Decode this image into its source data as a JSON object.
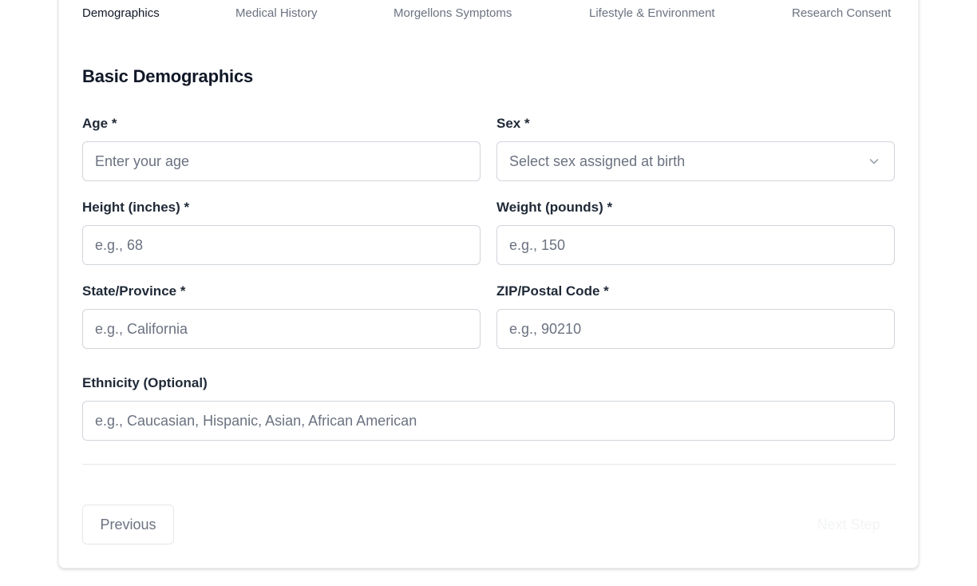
{
  "steps": [
    {
      "label": "Demographics",
      "active": true
    },
    {
      "label": "Medical History",
      "active": false
    },
    {
      "label": "Morgellons Symptoms",
      "active": false
    },
    {
      "label": "Lifestyle & Environment",
      "active": false
    },
    {
      "label": "Research Consent",
      "active": false
    }
  ],
  "section": {
    "title": "Basic Demographics"
  },
  "fields": {
    "age": {
      "label": "Age *",
      "placeholder": "Enter your age",
      "value": ""
    },
    "sex": {
      "label": "Sex *",
      "placeholder": "Select sex assigned at birth",
      "icon": "chevron-down-icon"
    },
    "height": {
      "label": "Height (inches) *",
      "placeholder": "e.g., 68",
      "value": ""
    },
    "weight": {
      "label": "Weight (pounds) *",
      "placeholder": "e.g., 150",
      "value": ""
    },
    "state": {
      "label": "State/Province *",
      "placeholder": "e.g., California",
      "value": ""
    },
    "zip": {
      "label": "ZIP/Postal Code *",
      "placeholder": "e.g., 90210",
      "value": ""
    },
    "ethnicity": {
      "label": "Ethnicity (Optional)",
      "placeholder": "e.g., Caucasian, Hispanic, Asian, African American",
      "value": ""
    }
  },
  "buttons": {
    "previous": "Previous",
    "next": "Next Step"
  }
}
